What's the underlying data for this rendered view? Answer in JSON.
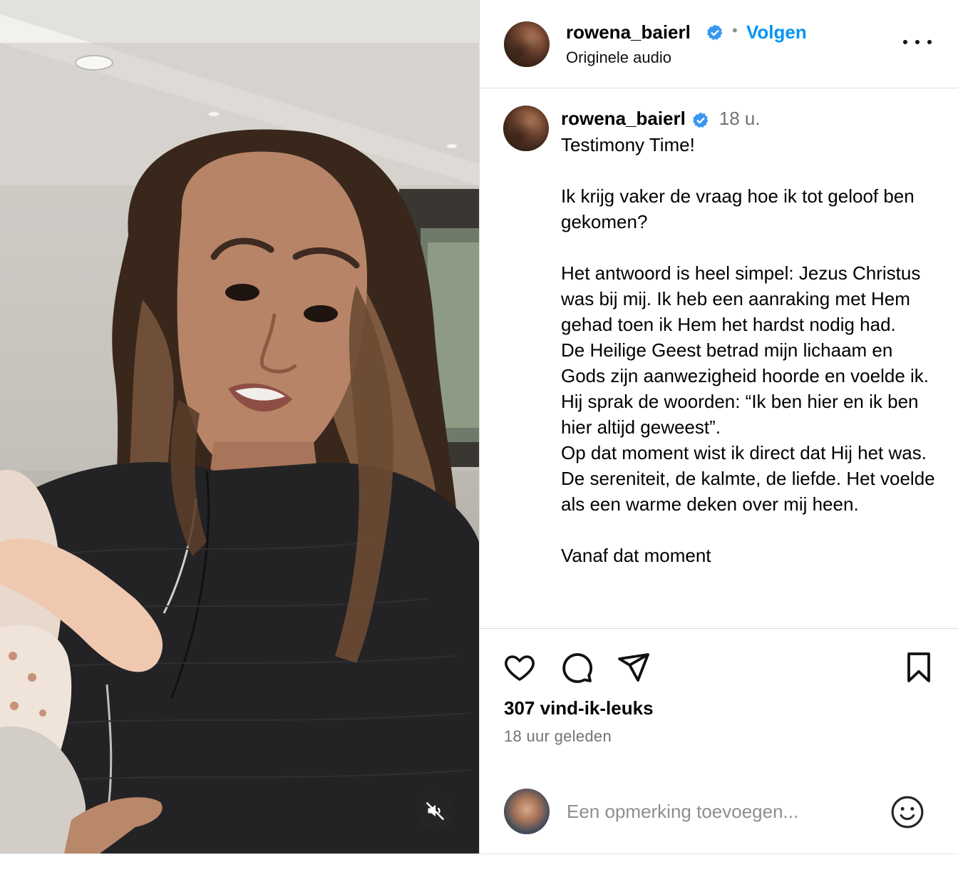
{
  "post": {
    "username": "rowena_baierl",
    "follow_label": "Volgen",
    "separator": "•",
    "audio_label": "Originele audio",
    "more_label": "Meer opties"
  },
  "caption": {
    "username": "rowena_baierl",
    "time": "18 u.",
    "text": "Testimony Time!\n\nIk krijg vaker de vraag hoe ik tot geloof ben gekomen?\n\nHet antwoord is heel simpel: Jezus Christus was bij mij. Ik heb een aanraking met Hem gehad toen ik Hem het hardst nodig had.\nDe Heilige Geest betrad mijn lichaam en Gods zijn aanwezigheid hoorde en voelde ik. Hij sprak de woorden: “Ik ben hier en ik ben hier altijd geweest”.\nOp dat moment wist ik direct dat Hij het was.\nDe sereniteit, de kalmte, de liefde. Het voelde als een warme deken over mij heen.\n\nVanaf dat moment"
  },
  "actions": {
    "like_icon": "heart-icon",
    "comment_icon": "comment-bubble-icon",
    "share_icon": "paper-plane-icon",
    "save_icon": "bookmark-icon",
    "likes_count": "307 vind-ik-leuks",
    "posted_ago": "18 uur geleden"
  },
  "comment": {
    "placeholder": "Een opmerking toevoegen...",
    "emoji_icon": "smiley-icon"
  },
  "video": {
    "mute_icon": "speaker-muted-icon"
  },
  "colors": {
    "accent": "#0095f6",
    "verified": "#3897f0",
    "muted_text": "#737373",
    "divider": "#dbdbdb"
  }
}
